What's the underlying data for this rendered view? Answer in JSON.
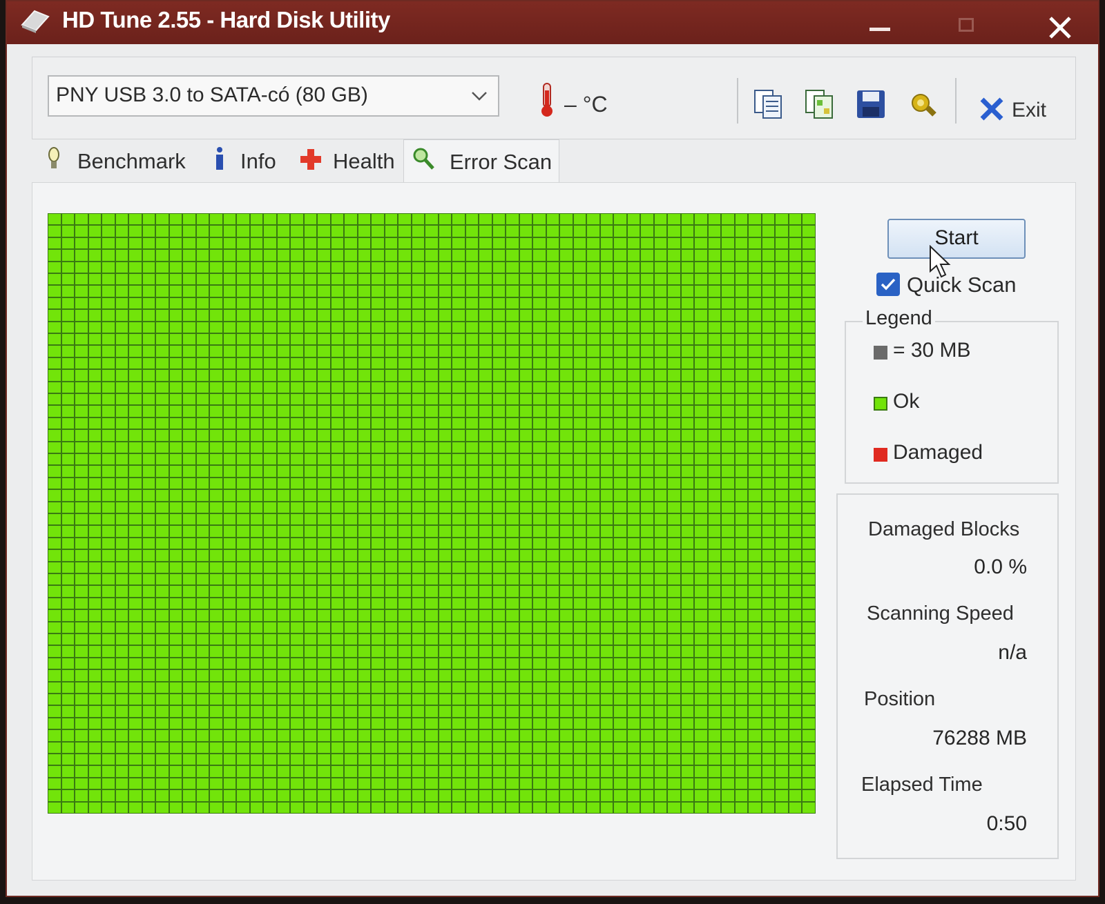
{
  "window": {
    "title": "HD Tune 2.55 - Hard Disk Utility"
  },
  "toolbar": {
    "drive": "PNY USB 3.0 to SATA-có (80 GB)",
    "temperature": "– °C",
    "exit_label": "Exit",
    "icons": [
      "copy-icon",
      "copy-all-icon",
      "save-icon",
      "options-icon"
    ]
  },
  "tabs": [
    {
      "label": "Benchmark",
      "icon": "bulb-icon"
    },
    {
      "label": "Info",
      "icon": "info-icon"
    },
    {
      "label": "Health",
      "icon": "health-cross-icon"
    },
    {
      "label": "Error Scan",
      "icon": "magnifier-icon",
      "active": true
    }
  ],
  "scan": {
    "columns": 57,
    "rows": 50,
    "damaged_blocks": 0,
    "ok_color": "#72e40a",
    "damaged_color": "#e02a20",
    "border_color": "#3a7a12"
  },
  "controls": {
    "start_label": "Start",
    "quick_scan_label": "Quick Scan",
    "quick_scan_checked": true
  },
  "legend": {
    "title": "Legend",
    "block_size": "= 30 MB",
    "ok": "Ok",
    "damaged": "Damaged"
  },
  "stats": {
    "damaged_blocks_label": "Damaged Blocks",
    "damaged_blocks_value": "0.0 %",
    "scanning_speed_label": "Scanning Speed",
    "scanning_speed_value": "n/a",
    "position_label": "Position",
    "position_value": "76288 MB",
    "elapsed_time_label": "Elapsed Time",
    "elapsed_time_value": "0:50"
  }
}
